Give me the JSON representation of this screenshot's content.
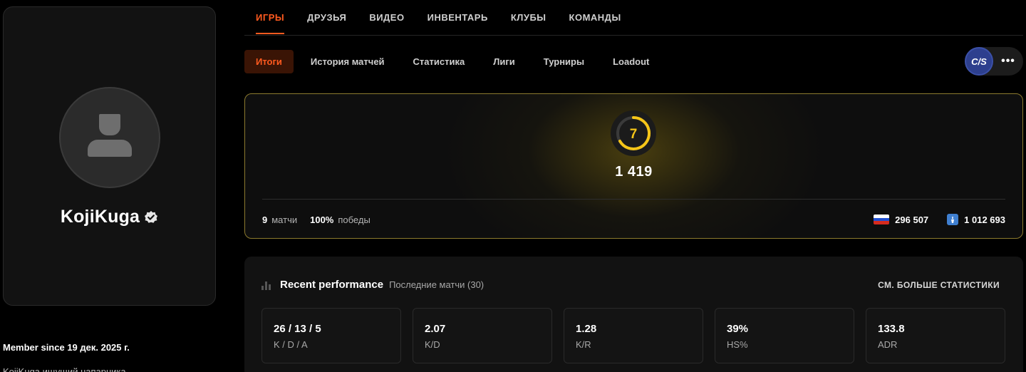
{
  "profile": {
    "username": "KojiKuga",
    "member_since": "Member since 19 дек. 2025 г.",
    "bio_preview": "KojiKuga ищущий напарника"
  },
  "main_tabs": [
    {
      "label": "ИГРЫ",
      "active": true
    },
    {
      "label": "ДРУЗЬЯ"
    },
    {
      "label": "ВИДЕО"
    },
    {
      "label": "ИНВЕНТАРЬ"
    },
    {
      "label": "КЛУБЫ"
    },
    {
      "label": "КОМАНДЫ"
    }
  ],
  "sub_tabs": [
    {
      "label": "Итоги",
      "active": true
    },
    {
      "label": "История матчей"
    },
    {
      "label": "Статистика"
    },
    {
      "label": "Лиги"
    },
    {
      "label": "Турниры"
    },
    {
      "label": "Loadout"
    }
  ],
  "game_switch": {
    "badge": "C/S",
    "more": "•••"
  },
  "elo": {
    "level": "7",
    "level_color": "#f5c518",
    "value": "1 419",
    "matches_count": "9",
    "matches_label": "матчи",
    "winrate": "100%",
    "winrate_label": "победы",
    "country_rank": "296 507",
    "global_rank": "1 012 693"
  },
  "performance": {
    "title": "Recent performance",
    "subtitle": "Последние матчи (30)",
    "more_link": "СМ. БОЛЬШЕ СТАТИСТИКИ",
    "stats": [
      {
        "value": "26 / 13 / 5",
        "label": "K / D / A"
      },
      {
        "value": "2.07",
        "label": "K/D"
      },
      {
        "value": "1.28",
        "label": "K/R"
      },
      {
        "value": "39%",
        "label": "HS%"
      },
      {
        "value": "133.8",
        "label": "ADR"
      }
    ]
  },
  "colors": {
    "accent": "#ff5a1f",
    "level": "#f5c518"
  }
}
